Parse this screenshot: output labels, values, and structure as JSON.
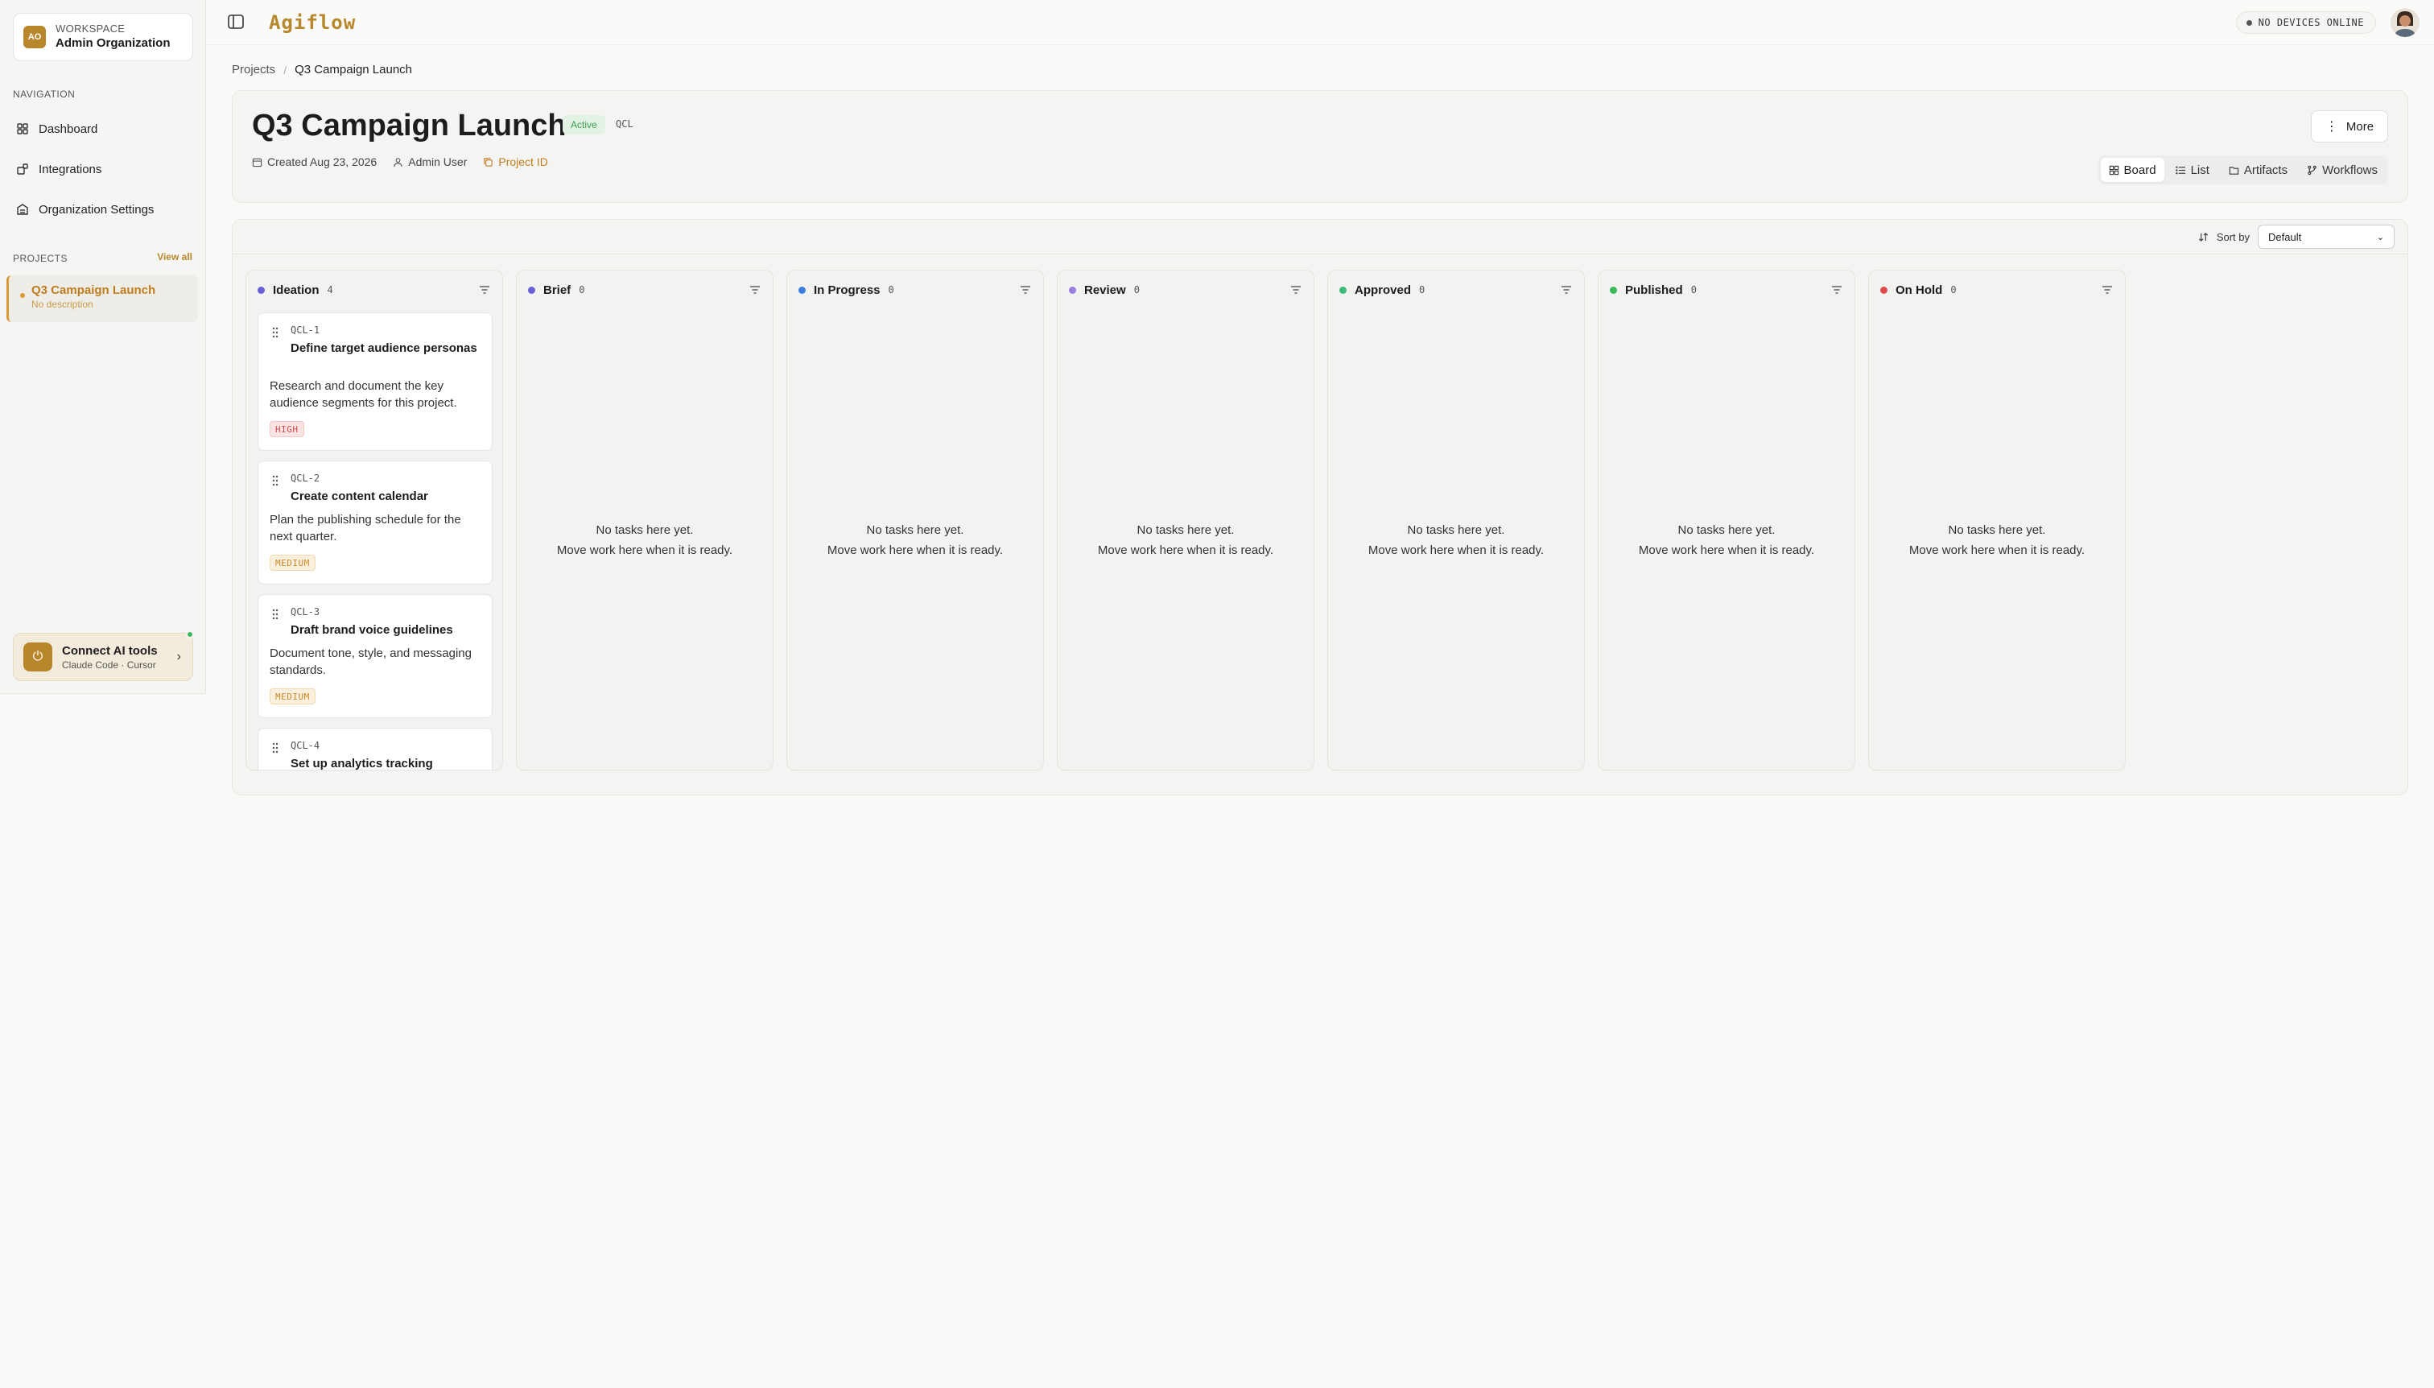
{
  "workspace": {
    "initials": "AO",
    "label": "WORKSPACE",
    "name": "Admin Organization"
  },
  "nav": {
    "label": "NAVIGATION",
    "items": [
      {
        "label": "Dashboard",
        "icon": "grid-icon"
      },
      {
        "label": "Integrations",
        "icon": "puzzle-icon"
      },
      {
        "label": "Organization Settings",
        "icon": "building-icon"
      }
    ]
  },
  "projects": {
    "label": "PROJECTS",
    "view_all": "View all",
    "items": [
      {
        "name": "Q3 Campaign Launch",
        "desc": "No description"
      }
    ]
  },
  "ai_card": {
    "title": "Connect AI tools",
    "subtitle": "Claude Code · Cursor"
  },
  "topbar": {
    "brand": "Agiflow",
    "status": "NO DEVICES ONLINE"
  },
  "breadcrumb": {
    "root": "Projects",
    "separator": "/",
    "current": "Q3 Campaign Launch"
  },
  "header": {
    "title": "Q3 Campaign Launch",
    "status": "Active",
    "key": "QCL",
    "created": "Created Aug 23, 2026",
    "owner": "Admin User",
    "project_id": "Project ID",
    "more": "More",
    "tabs": [
      "Board",
      "List",
      "Artifacts",
      "Workflows"
    ]
  },
  "board": {
    "sort_label": "Sort by",
    "sort_value": "Default",
    "empty_line1": "No tasks here yet.",
    "empty_line2": "Move work here when it is ready.",
    "columns": [
      {
        "title": "Ideation",
        "count": "4",
        "color": "#6b5fd6"
      },
      {
        "title": "Brief",
        "count": "0",
        "color": "#6b5fd6"
      },
      {
        "title": "In Progress",
        "count": "0",
        "color": "#3b7fe0"
      },
      {
        "title": "Review",
        "count": "0",
        "color": "#9a7fe0"
      },
      {
        "title": "Approved",
        "count": "0",
        "color": "#3dbb7a"
      },
      {
        "title": "Published",
        "count": "0",
        "color": "#3dbb5a"
      },
      {
        "title": "On Hold",
        "count": "0",
        "color": "#e04a4a"
      }
    ],
    "tasks": [
      {
        "key": "QCL-1",
        "title": "Define target audience personas",
        "desc": "Research and document the key audience segments for this project.",
        "priority": "HIGH"
      },
      {
        "key": "QCL-2",
        "title": "Create content calendar",
        "desc": "Plan the publishing schedule for the next quarter.",
        "priority": "MEDIUM"
      },
      {
        "key": "QCL-3",
        "title": "Draft brand voice guidelines",
        "desc": "Document tone, style, and messaging standards.",
        "priority": "MEDIUM"
      },
      {
        "key": "QCL-4",
        "title": "Set up analytics tracking"
      }
    ]
  }
}
